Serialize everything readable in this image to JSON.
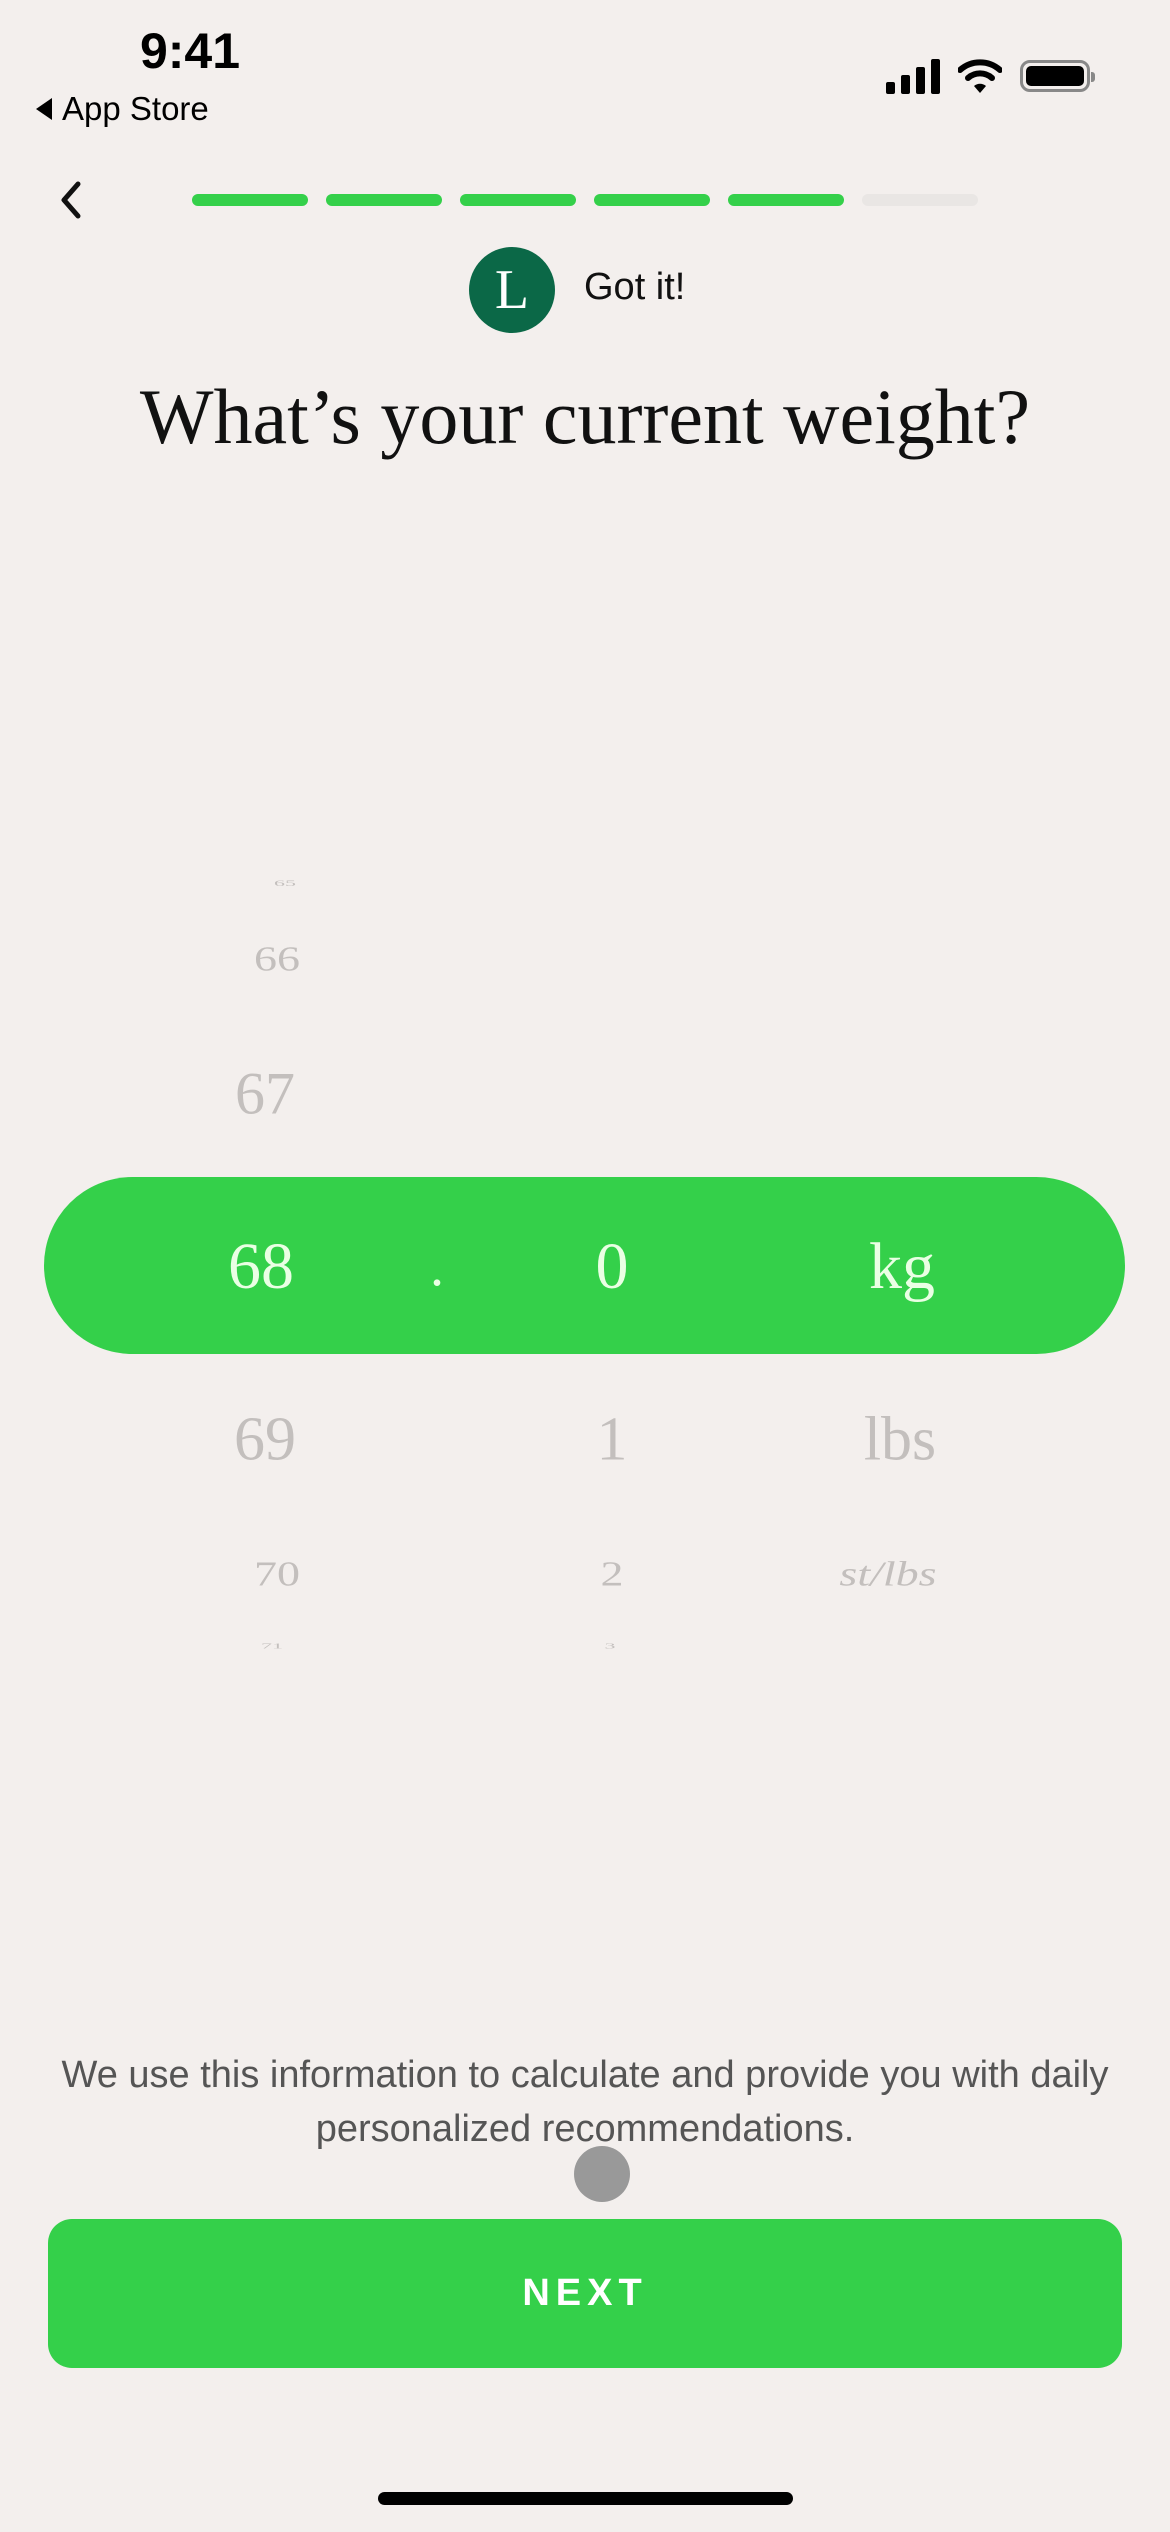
{
  "status_bar": {
    "time": "9:41",
    "back_app": "App Store",
    "icons": [
      "cellular-signal-icon",
      "wifi-icon",
      "battery-icon"
    ]
  },
  "nav": {
    "back_icon": "chevron-left-icon"
  },
  "progress": {
    "total_steps": 6,
    "completed_steps": 5,
    "active_color": "#34d04a",
    "inactive_color": "#e9e6e4"
  },
  "coach": {
    "avatar_letter": "L",
    "message": "Got it!",
    "avatar_color": "#0b6847"
  },
  "title": "What’s your current weight?",
  "picker": {
    "integer": {
      "above": [
        "65",
        "66",
        "67"
      ],
      "selected": "68",
      "below": [
        "69",
        "70",
        "71"
      ]
    },
    "separator": ".",
    "decimal": {
      "selected": "0",
      "below": [
        "1",
        "2",
        "3"
      ]
    },
    "unit": {
      "selected": "kg",
      "below": [
        "lbs",
        "st/lbs"
      ]
    },
    "highlight_color": "#34d04a"
  },
  "disclaimer": "We use this information to calculate and provide you with daily personalized recommendations.",
  "next_button": "NEXT"
}
